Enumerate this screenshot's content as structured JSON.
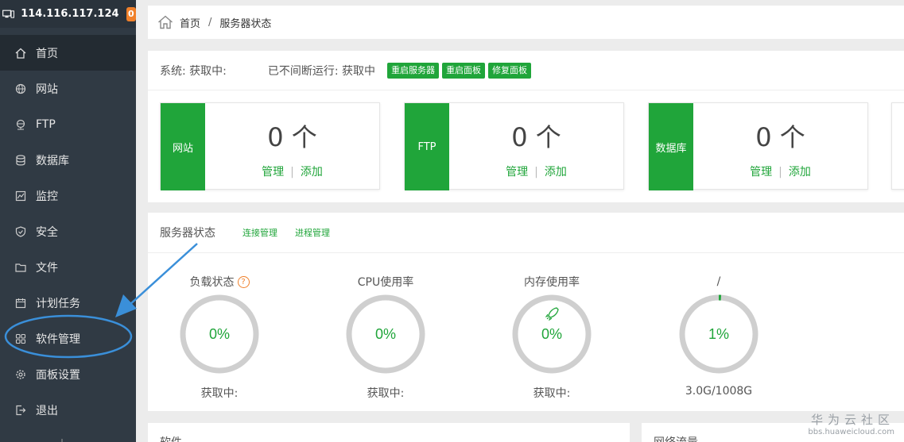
{
  "header": {
    "ip": "114.116.117.124",
    "badge": "0"
  },
  "sidebar": {
    "items": [
      {
        "label": "首页",
        "icon": "home-icon"
      },
      {
        "label": "网站",
        "icon": "globe-icon"
      },
      {
        "label": "FTP",
        "icon": "network-icon"
      },
      {
        "label": "数据库",
        "icon": "database-icon"
      },
      {
        "label": "监控",
        "icon": "monitor-icon"
      },
      {
        "label": "安全",
        "icon": "shield-icon"
      },
      {
        "label": "文件",
        "icon": "folder-icon"
      },
      {
        "label": "计划任务",
        "icon": "calendar-icon"
      },
      {
        "label": "软件管理",
        "icon": "grid-icon"
      },
      {
        "label": "面板设置",
        "icon": "gear-icon"
      },
      {
        "label": "退出",
        "icon": "logout-icon"
      }
    ],
    "active_index": 0
  },
  "breadcrumb": {
    "home": "首页",
    "separator": "/",
    "current": "服务器状态"
  },
  "system": {
    "system_text": "系统: 获取中:",
    "uptime_text": "已不间断运行: 获取中",
    "buttons": [
      "重启服务器",
      "重启面板",
      "修复面板"
    ]
  },
  "cards": [
    {
      "tag": "网站",
      "count": "0 个",
      "manage": "管理",
      "sep": "|",
      "add": "添加"
    },
    {
      "tag": "FTP",
      "count": "0 个",
      "manage": "管理",
      "sep": "|",
      "add": "添加"
    },
    {
      "tag": "数据库",
      "count": "0 个",
      "manage": "管理",
      "sep": "|",
      "add": "添加"
    }
  ],
  "status": {
    "title": "服务器状态",
    "links": [
      "连接管理",
      "进程管理"
    ],
    "help_mark": "?",
    "gauges": [
      {
        "title": "负载状态",
        "value": "0%",
        "footer": "获取中:",
        "percent": 0
      },
      {
        "title": "CPU使用率",
        "value": "0%",
        "footer": "获取中:",
        "percent": 0
      },
      {
        "title": "内存使用率",
        "value": "0%",
        "footer": "获取中:",
        "percent": 0,
        "icon": "rocket-icon"
      },
      {
        "title": "/",
        "value": "1%",
        "footer": "3.0G/1008G",
        "percent": 1
      }
    ]
  },
  "bottom": {
    "left_title": "软件",
    "right_title": "网络流量"
  },
  "watermark": {
    "line1": "华为云社区",
    "line2": "bbs.huaweicloud.com"
  },
  "colors": {
    "accent": "#20a53a",
    "sidebar": "#303a44",
    "badge": "#f0802a",
    "annotation": "#3a8fd9"
  }
}
